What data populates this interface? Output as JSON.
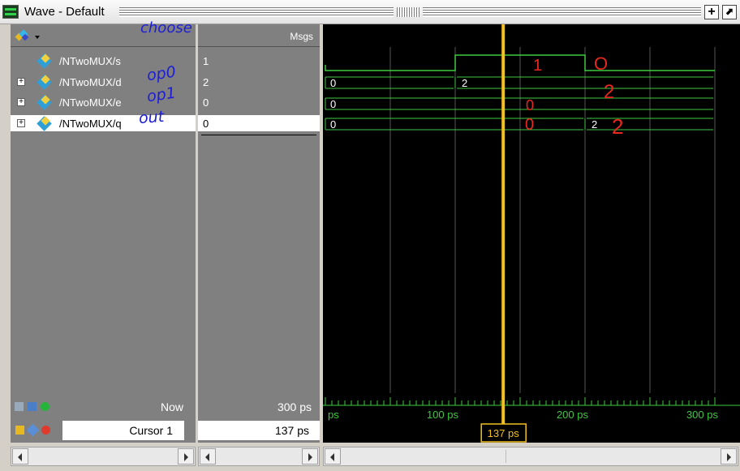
{
  "window": {
    "title": "Wave - Default",
    "icon": "wave-window-icon",
    "buttons": [
      {
        "name": "dock-button",
        "glyph": "+"
      },
      {
        "name": "undock-button",
        "glyph": "⬈"
      }
    ]
  },
  "toolbar": {
    "wave_icon": "wave-icon",
    "msgs_header": "Msgs"
  },
  "signals": [
    {
      "name": "/NTwoMUX/s",
      "value": "1",
      "expandable": false,
      "annotation": "choose"
    },
    {
      "name": "/NTwoMUX/d",
      "value": "2",
      "expandable": true,
      "annotation": "op0"
    },
    {
      "name": "/NTwoMUX/e",
      "value": "0",
      "expandable": true,
      "annotation": "op1"
    },
    {
      "name": "/NTwoMUX/q",
      "value": "0",
      "expandable": true,
      "annotation": "out",
      "selected": true
    }
  ],
  "waveform": {
    "bus_labels": {
      "d_start": "0",
      "d_after": "2",
      "e_start": "0",
      "q_start": "0",
      "q_after": "2"
    },
    "annotations": {
      "s_high": "1",
      "s_low": "O",
      "d_after": "2",
      "e_mid": "0",
      "q_mid": "0",
      "q_after": "2"
    },
    "cursor_time_ps": 137
  },
  "timeline": {
    "now_label": "Now",
    "now_value": "300 ps",
    "cursor_label": "Cursor 1",
    "cursor_value": "137 ps",
    "ruler_labels": [
      "ps",
      "100 ps",
      "200 ps",
      "300 ps"
    ],
    "cursor_badge": "137 ps"
  },
  "colors": {
    "wave_green": "#3ec93e",
    "cursor_yellow": "#f4c020",
    "annotation_blue": "#1d1dd6",
    "annotation_red": "#e8281e"
  }
}
